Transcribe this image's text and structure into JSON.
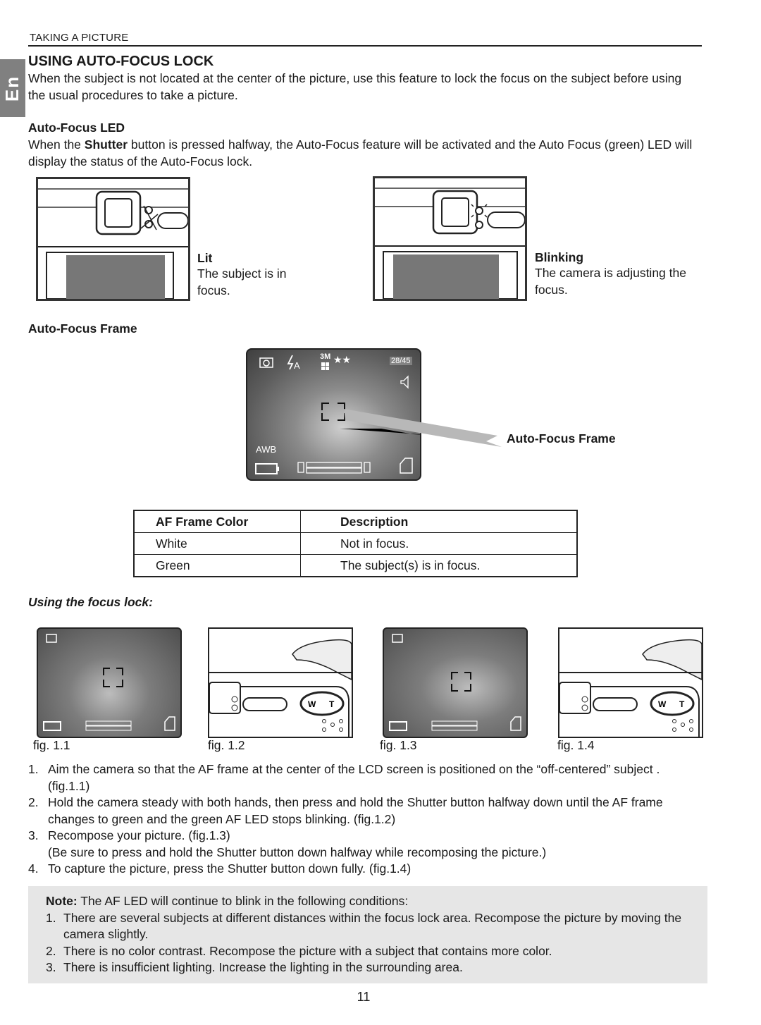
{
  "header": {
    "section_label": "TAKING A PICTURE",
    "language_tab": "En"
  },
  "title": "USING AUTO-FOCUS LOCK",
  "intro": "When the subject is not located at the center of the picture, use this feature to lock the focus on the subject before using the usual procedures to take a picture.",
  "af_led": {
    "heading": "Auto-Focus LED",
    "text_before": "When the ",
    "text_bold": "Shutter",
    "text_after": " button is pressed halfway, the Auto-Focus feature will be activated and the Auto Focus (green) LED will display the status of the Auto-Focus lock.",
    "states": [
      {
        "title": "Lit",
        "description": "The subject is in focus."
      },
      {
        "title": "Blinking",
        "description": "The camera is adjusting the focus."
      }
    ]
  },
  "af_frame": {
    "heading": "Auto-Focus Frame",
    "callout": "Auto-Focus Frame",
    "lcd": {
      "shot_counter": "28/45",
      "resolution": "3M",
      "quality": "★★",
      "white_balance": "AWB",
      "flash_mode": "A",
      "icons": [
        "camera-mode-icon",
        "flash-auto-icon",
        "resolution-icon",
        "quality-stars-icon",
        "speaker-icon",
        "battery-icon",
        "zoom-bar-icon",
        "memory-card-icon"
      ]
    }
  },
  "table": {
    "headers": [
      "AF Frame Color",
      "Description"
    ],
    "rows": [
      [
        "White",
        "Not in focus."
      ],
      [
        "Green",
        "The subject(s) is in focus."
      ]
    ]
  },
  "focus_lock": {
    "heading": "Using the focus lock:",
    "figures": [
      "fig. 1.1",
      "fig. 1.2",
      "fig. 1.3",
      "fig. 1.4"
    ],
    "zoom_labels": {
      "wide": "W",
      "tele": "T"
    },
    "steps": [
      {
        "num": "1.",
        "text": "Aim the camera so that the AF frame at the center of the LCD screen is positioned on the “off-centered” subject . (fig.1.1)"
      },
      {
        "num": "2.",
        "text": "Hold the camera steady with both hands, then press and hold the Shutter button halfway down until the AF frame changes to green and the green AF LED stops blinking. (fig.1.2)"
      },
      {
        "num": "3.",
        "text": "Recompose your picture. (fig.1.3)\n(Be sure to press and hold the Shutter button down halfway while recomposing the picture.)"
      },
      {
        "num": "4.",
        "text": "To capture the picture, press the Shutter button down fully. (fig.1.4)"
      }
    ]
  },
  "note": {
    "label": "Note:",
    "intro": " The AF LED will continue to blink in the following conditions:",
    "items": [
      {
        "num": "1.",
        "text": "There are several subjects at different distances within the focus lock area. Recompose the picture by moving the camera slightly."
      },
      {
        "num": "2.",
        "text": "There is no color contrast. Recompose the picture with a subject that contains more color."
      },
      {
        "num": "3.",
        "text": "There is insufficient lighting. Increase the lighting in the surrounding area."
      }
    ]
  },
  "page_number": "11"
}
